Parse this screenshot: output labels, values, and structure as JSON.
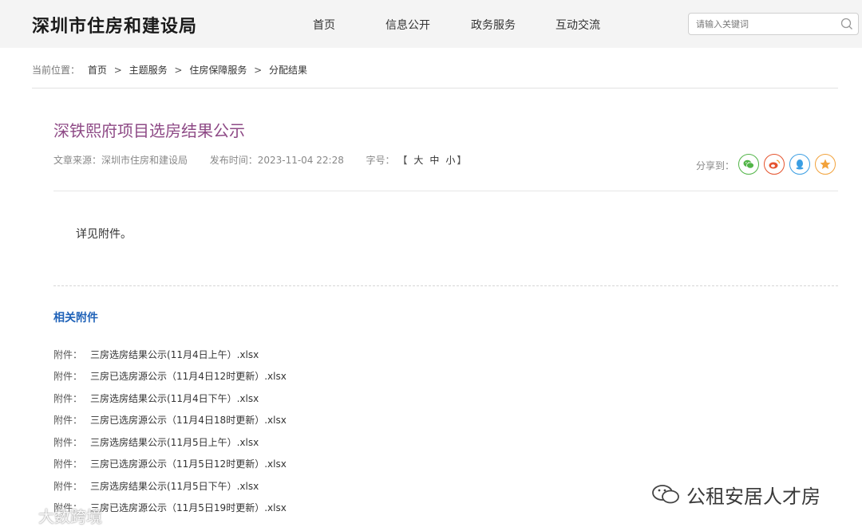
{
  "header": {
    "logo": "深圳市住房和建设局",
    "nav": [
      {
        "label": "首页"
      },
      {
        "label": "信息公开"
      },
      {
        "label": "政务服务"
      },
      {
        "label": "互动交流"
      }
    ],
    "search_placeholder": "请输入关键词",
    "search_icon": "search-icon"
  },
  "breadcrumb": {
    "label": "当前位置：",
    "items": [
      "首页",
      "主题服务",
      "住房保障服务",
      "分配结果"
    ],
    "separator": ">"
  },
  "article": {
    "title": "深铁熙府项目选房结果公示",
    "source_label": "文章来源：",
    "source": "深圳市住房和建设局",
    "date_label": "发布时间：",
    "date": "2023-11-04 22:28",
    "font_label": "字号：",
    "font_open": "【",
    "font_sizes": [
      "大",
      "中",
      "小"
    ],
    "font_close": "】",
    "share_label": "分享到：",
    "share_buttons": [
      {
        "name": "wechat-icon",
        "color": "#52b548"
      },
      {
        "name": "weibo-icon",
        "color": "#e5532d"
      },
      {
        "name": "qq-icon",
        "color": "#3a9ee3"
      },
      {
        "name": "qzone-icon",
        "color": "#f2a23b"
      }
    ],
    "body": "详见附件。"
  },
  "attachments": {
    "title": "相关附件",
    "prefix": "附件：",
    "items": [
      "三房选房结果公示(11月4日上午）.xlsx",
      "三房已选房源公示（11月4日12时更新）.xlsx",
      "三房选房结果公示(11月4日下午）.xlsx",
      "三房已选房源公示（11月4日18时更新）.xlsx",
      "三房选房结果公示(11月5日上午）.xlsx",
      "三房已选房源公示（11月5日12时更新）.xlsx",
      "三房选房结果公示(11月5日下午）.xlsx",
      "三房已选房源公示（11月5日19时更新）.xlsx"
    ]
  },
  "watermarks": {
    "right": "公租安居人才房",
    "left": "大数跨境"
  }
}
